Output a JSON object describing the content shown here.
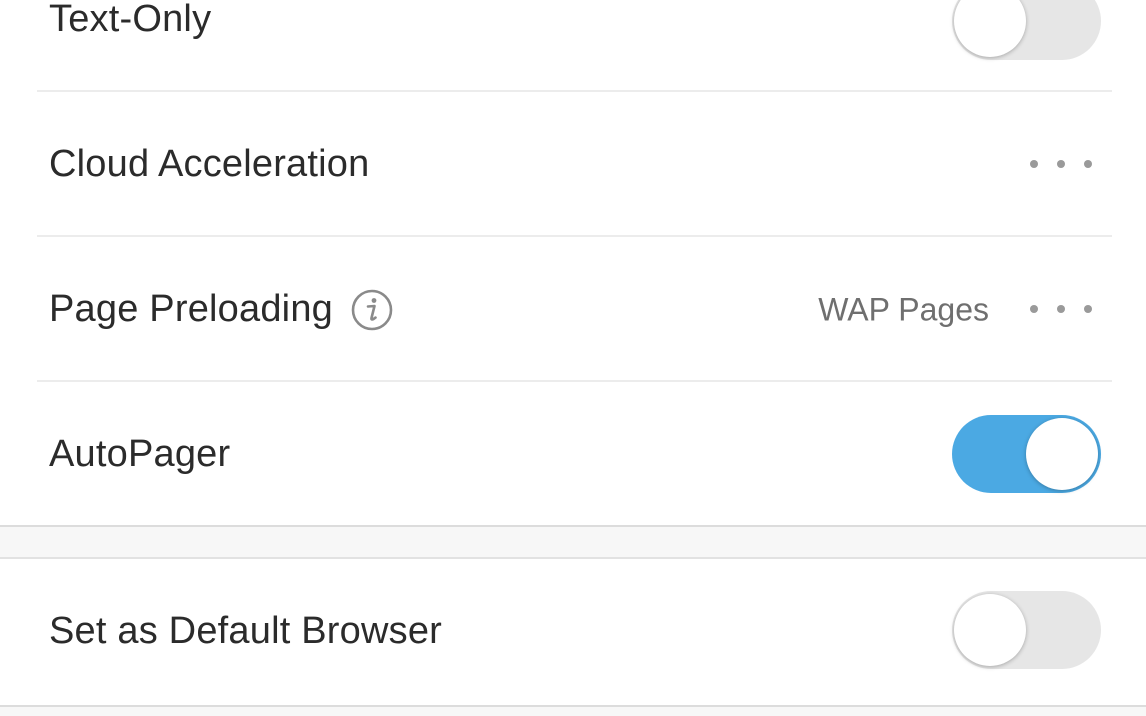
{
  "settings": {
    "text_only": {
      "label": "Text-Only",
      "toggle_on": false
    },
    "cloud_acceleration": {
      "label": "Cloud Acceleration",
      "more_icon": "more-dots-icon"
    },
    "page_preloading": {
      "label": "Page Preloading",
      "info_icon": "info-icon",
      "value": "WAP Pages",
      "more_icon": "more-dots-icon"
    },
    "autopager": {
      "label": "AutoPager",
      "toggle_on": true
    },
    "default_browser": {
      "label": "Set as Default Browser",
      "toggle_on": false
    }
  },
  "colors": {
    "toggle_on": "#4ba9e3",
    "toggle_off": "#e6e6e6",
    "text": "#2b2b2b",
    "secondary_text": "#6f6f6f"
  }
}
